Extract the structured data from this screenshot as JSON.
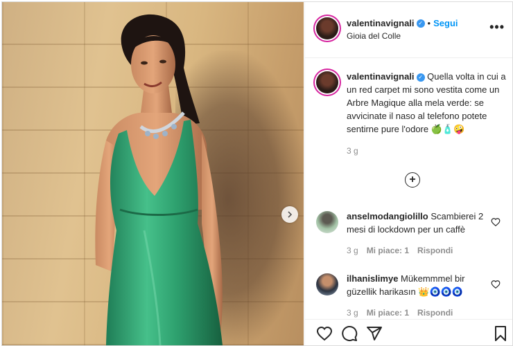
{
  "post": {
    "author": {
      "username": "valentinavignali",
      "verified": true,
      "location": "Gioia del Colle"
    },
    "follow_label": "Segui",
    "separator": "•",
    "more_label": "•••",
    "caption": {
      "username": "valentinavignali",
      "text": "Quella volta in cui a un red carpet mi sono vestita come un Arbre Magique alla mela verde: se avvicinate il naso al telefono potete sentirne pure l'odore 🍏🧴🤪",
      "time": "3 g"
    },
    "load_more_label": "+",
    "comments": [
      {
        "username": "anselmodangiolillo",
        "text": "Scambierei 2 mesi di lockdown per un caffè",
        "time": "3 g",
        "likes": "Mi piace: 1",
        "reply": "Rispondi"
      },
      {
        "username": "ilhanislimye",
        "text": "Mükemmmel bir güzellik harikasın 👑🧿🧿🧿",
        "time": "3 g",
        "likes": "Mi piace: 1",
        "reply": "Rispondi"
      }
    ],
    "icons": {
      "like": "heart-icon",
      "comment": "comment-icon",
      "share": "share-icon",
      "save": "bookmark-icon",
      "next": "chevron-right-icon"
    },
    "colors": {
      "accent": "#0095f6",
      "dress": "#2e9a6c",
      "wall": "#d9b781"
    }
  }
}
